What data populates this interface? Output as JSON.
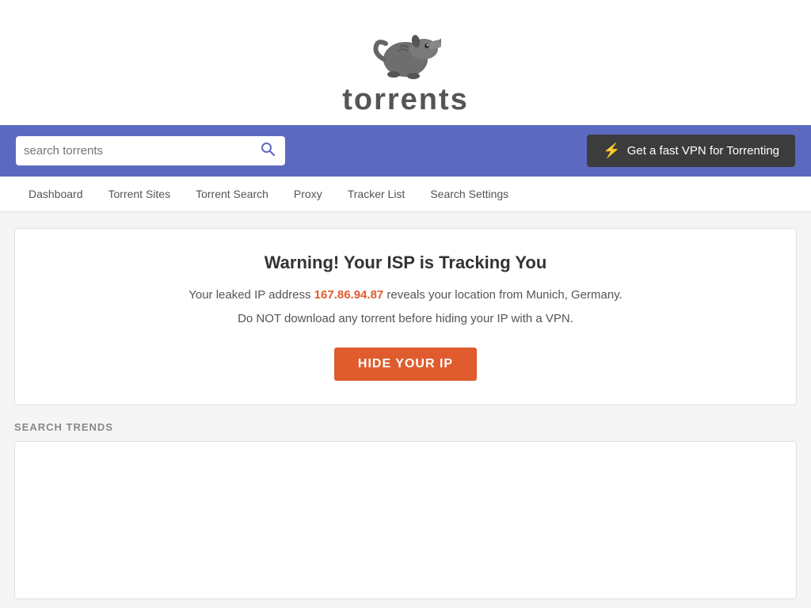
{
  "header": {
    "logo_text": "torrents",
    "logo_dots": "· ·"
  },
  "search_bar": {
    "placeholder": "search torrents",
    "vpn_button_label": "Get a fast VPN for Torrenting",
    "lightning_icon": "⚡"
  },
  "nav": {
    "items": [
      {
        "label": "Dashboard",
        "id": "dashboard"
      },
      {
        "label": "Torrent Sites",
        "id": "torrent-sites"
      },
      {
        "label": "Torrent Search",
        "id": "torrent-search"
      },
      {
        "label": "Proxy",
        "id": "proxy"
      },
      {
        "label": "Tracker List",
        "id": "tracker-list"
      },
      {
        "label": "Search Settings",
        "id": "search-settings"
      }
    ]
  },
  "warning": {
    "title": "Warning! Your ISP is Tracking You",
    "line1_prefix": "Your leaked IP address ",
    "ip_address": "167.86.94.87",
    "line1_suffix": " reveals your location from Munich, Germany.",
    "line2": "Do NOT download any torrent before hiding your IP with a VPN.",
    "hide_ip_label": "HIDE YOUR IP"
  },
  "search_trends": {
    "section_label": "SEARCH TRENDS"
  }
}
